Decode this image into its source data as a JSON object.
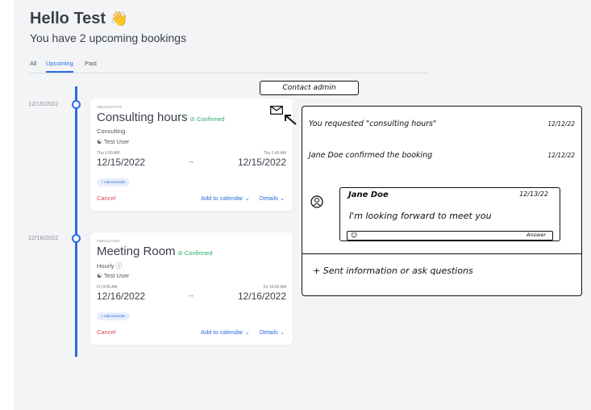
{
  "header": {
    "greeting": "Hello Test",
    "wave_emoji": "👋",
    "subtitle": "You have 2 upcoming bookings"
  },
  "tabs": [
    {
      "label": "All",
      "active": false
    },
    {
      "label": "Upcoming",
      "active": true
    },
    {
      "label": "Past",
      "active": false
    }
  ],
  "bookings": [
    {
      "date_label": "12/15/2022",
      "booking_id": "#BB240307075",
      "title": "Consulting hours",
      "status": "Confirmed",
      "type": "Consulting",
      "user": "Test User",
      "start_time": "Thu 1:00 AM",
      "start_date": "12/15/2022",
      "end_time": "Thu 1:45 AM",
      "end_date": "12/15/2022",
      "reminder_label": "+ Add reminder",
      "cancel_label": "Cancel",
      "calendar_label": "Add to calendar",
      "details_label": "Details"
    },
    {
      "date_label": "12/16/2022",
      "booking_id": "#BB24224684",
      "title": "Meeting Room",
      "status": "Confirmed",
      "type": "Hourly",
      "user": "Test User",
      "start_time": "Fri 9:00 AM",
      "start_date": "12/16/2022",
      "end_time": "Fri 10:00 AM",
      "end_date": "12/16/2022",
      "reminder_label": "+ Add reminder",
      "cancel_label": "Cancel",
      "calendar_label": "Add to calendar",
      "details_label": "Details"
    }
  ],
  "sketch": {
    "contact_admin": "Contact admin",
    "log": [
      {
        "text": "You requested \"consulting hours\"",
        "date": "12/12/22"
      },
      {
        "text": "Jane Doe confirmed the booking",
        "date": "12/12/22"
      }
    ],
    "message": {
      "sender": "Jane Doe",
      "date": "12/13/22",
      "text": "I'm looking forward to meet you",
      "answer_label": "Answer"
    },
    "sent_info": "+ Sent information or ask questions"
  },
  "colors": {
    "accent": "#2d6cdf",
    "confirmed": "#28a969",
    "cancel": "#e0454a"
  }
}
